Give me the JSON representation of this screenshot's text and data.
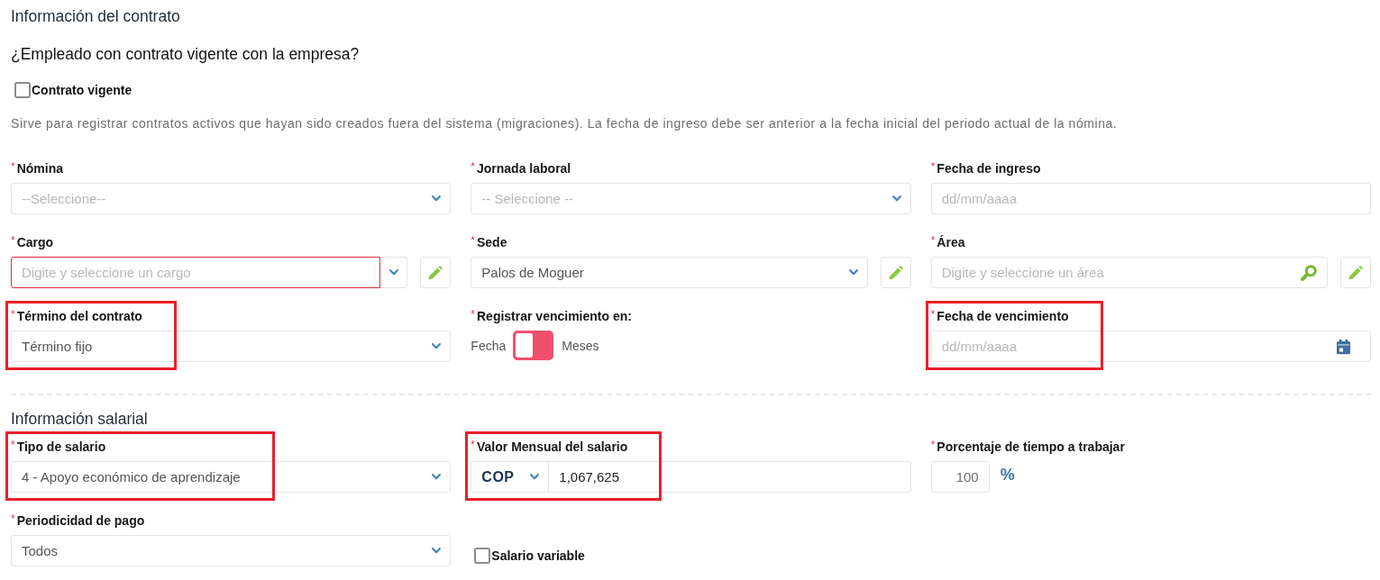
{
  "contract": {
    "title": "Información del contrato",
    "question": "¿Empleado con contrato vigente con la empresa?",
    "current_contract": {
      "label": "Contrato vigente",
      "checked": false
    },
    "help_text": "Sirve para registrar contratos activos que hayan sido creados fuera del sistema (migraciones). La fecha de ingreso debe ser anterior a la fecha inicial del periodo actual de la nómina.",
    "fields": [
      {
        "kind": "select",
        "required_mark": "*",
        "label": "Nómina",
        "placeholder": "--Seleccione--",
        "invalid": false,
        "highlighted": false
      },
      {
        "kind": "select",
        "required_mark": "*",
        "label": "Jornada laboral",
        "placeholder": "-- Seleccione --",
        "invalid": false,
        "highlighted": false
      },
      {
        "kind": "date",
        "required_mark": "*",
        "label": "Fecha de ingreso",
        "placeholder": "dd/mm/aaaa",
        "invalid": false,
        "highlighted": false
      },
      {
        "kind": "combo_edit",
        "required_mark": "*",
        "label": "Cargo",
        "placeholder": "Digite y seleccione un cargo",
        "invalid": true,
        "highlighted": false
      },
      {
        "kind": "select_edit",
        "required_mark": "*",
        "label": "Sede",
        "value": "Palos de Moguer",
        "invalid": false,
        "highlighted": false
      },
      {
        "kind": "search_edit",
        "required_mark": "*",
        "label": "Área",
        "placeholder": "Digite y seleccione un área",
        "invalid": false,
        "highlighted": false
      },
      {
        "kind": "select",
        "required_mark": "*",
        "label": "Término del contrato",
        "value": "Término fijo",
        "invalid": false,
        "highlighted": true
      },
      {
        "kind": "toggle",
        "required_mark": "*",
        "label": "Registrar vencimiento en:",
        "off_label": "Fecha",
        "on_label": "Meses",
        "on": false,
        "highlighted": false
      },
      {
        "kind": "date_picker",
        "required_mark": "*",
        "label": "Fecha de vencimiento",
        "placeholder": "dd/mm/aaaa",
        "invalid": false,
        "highlighted": true
      }
    ]
  },
  "salary": {
    "title": "Información salarial",
    "fields": [
      {
        "kind": "select",
        "required_mark": "*",
        "label": "Tipo de salario",
        "value": "4 - Apoyo económico de aprendizaje",
        "invalid": false,
        "highlighted": true
      },
      {
        "kind": "currency",
        "required_mark": "*",
        "label": "Valor Mensual del salario",
        "currency": "COP",
        "value": "1,067,625",
        "invalid": false,
        "highlighted": true
      },
      {
        "kind": "percent",
        "required_mark": "*",
        "label": "Porcentaje de tiempo a trabajar",
        "value": "100",
        "unit": "%",
        "invalid": false,
        "highlighted": false
      },
      {
        "kind": "select",
        "required_mark": "*",
        "label": "Periodicidad de pago",
        "value": "Todos",
        "invalid": false,
        "highlighted": false
      },
      {
        "kind": "checkbox",
        "label": "Salario variable",
        "checked": false,
        "highlighted": false
      }
    ]
  }
}
